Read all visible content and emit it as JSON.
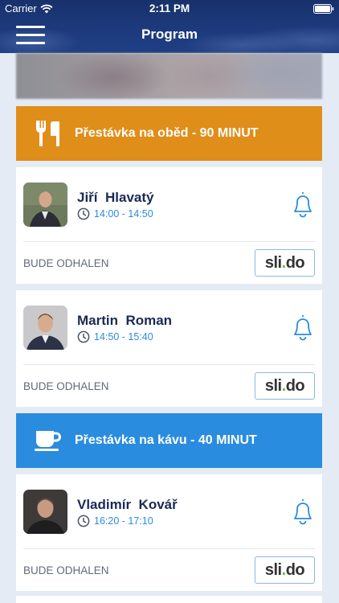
{
  "status_bar": {
    "carrier": "Carrier",
    "time": "2:11 PM",
    "wifi_icon": "wifi-icon",
    "battery_icon": "battery-icon"
  },
  "nav": {
    "title": "Program",
    "menu_icon": "menu-icon"
  },
  "breaks": {
    "lunch": {
      "label": "Přestávka na oběd - 90 MINUT",
      "icon": "fork-knife-icon",
      "color": "#e08e1a"
    },
    "coffee": {
      "label": "Přestávka na kávu - 40 MINUT",
      "icon": "coffee-cup-icon",
      "color": "#2a8cde"
    }
  },
  "talks": [
    {
      "first_name": "Jiří",
      "last_name": "Hlavatý",
      "time": "14:00 - 14:50",
      "room": "BUDE ODHALEN",
      "slido": "sli.do"
    },
    {
      "first_name": "Martin",
      "last_name": "Roman",
      "time": "14:50 - 15:40",
      "room": "BUDE ODHALEN",
      "slido": "sli.do"
    },
    {
      "first_name": "Vladimír",
      "last_name": "Kovář",
      "time": "16:20 - 17:10",
      "room": "BUDE ODHALEN",
      "slido": "sli.do"
    }
  ],
  "colors": {
    "header": "#1c3a7c",
    "accent_blue": "#2a8cde",
    "name_text": "#1a2a56",
    "background": "#e4ebf5"
  }
}
